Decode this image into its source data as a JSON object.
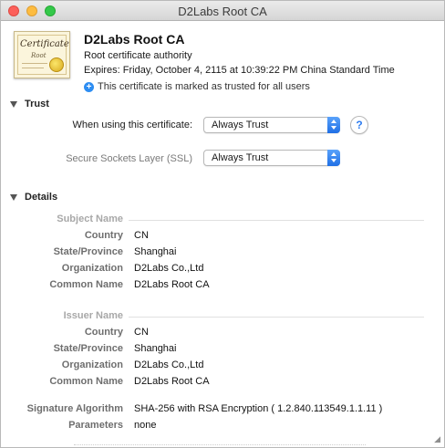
{
  "window": {
    "title": "D2Labs Root CA"
  },
  "header": {
    "icon_text_1": "Certificate",
    "icon_text_2": "Root",
    "name": "D2Labs Root CA",
    "kind": "Root certificate authority",
    "expires": "Expires: Friday, October 4, 2115 at 10:39:22 PM China Standard Time",
    "trusted_note": "This certificate is marked as trusted for all users"
  },
  "trust": {
    "heading": "Trust",
    "rows": [
      {
        "label": "When using this certificate:",
        "value": "Always Trust"
      },
      {
        "label": "Secure Sockets Layer (SSL)",
        "value": "Always Trust"
      }
    ],
    "help": "?"
  },
  "details": {
    "heading": "Details",
    "subject": {
      "heading": "Subject Name",
      "rows": [
        {
          "label": "Country",
          "value": "CN"
        },
        {
          "label": "State/Province",
          "value": "Shanghai"
        },
        {
          "label": "Organization",
          "value": "D2Labs Co.,Ltd"
        },
        {
          "label": "Common Name",
          "value": "D2Labs Root CA"
        }
      ]
    },
    "issuer": {
      "heading": "Issuer Name",
      "rows": [
        {
          "label": "Country",
          "value": "CN"
        },
        {
          "label": "State/Province",
          "value": "Shanghai"
        },
        {
          "label": "Organization",
          "value": "D2Labs Co.,Ltd"
        },
        {
          "label": "Common Name",
          "value": "D2Labs Root CA"
        }
      ]
    },
    "algorithm": {
      "rows": [
        {
          "label": "Signature Algorithm",
          "value": "SHA-256 with RSA Encryption ( 1.2.840.113549.1.1.11 )"
        },
        {
          "label": "Parameters",
          "value": "none"
        }
      ]
    }
  }
}
